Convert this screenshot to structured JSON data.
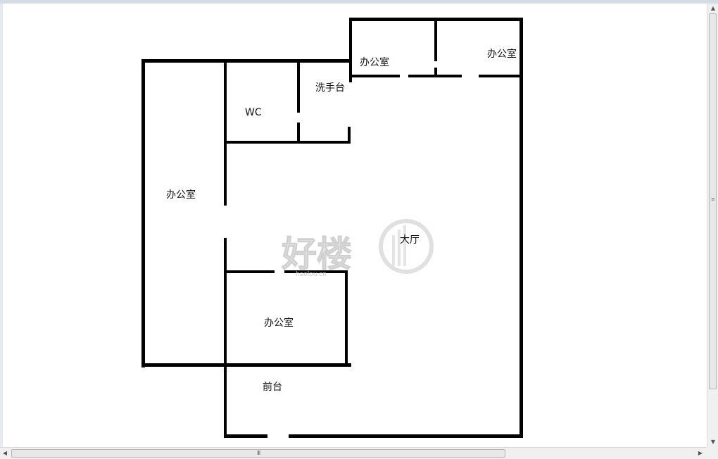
{
  "rooms": {
    "office_left": "办公室",
    "wc": "WC",
    "washbasin": "洗手台",
    "office_top_left": "办公室",
    "office_top_right": "办公室",
    "hall": "大厅",
    "office_middle": "办公室",
    "reception": "前台"
  },
  "watermark": {
    "text": "好楼",
    "subtext": "haolou.cn"
  },
  "scrollbars": {
    "vertical_grip": "≡",
    "horizontal_grip": "III"
  }
}
